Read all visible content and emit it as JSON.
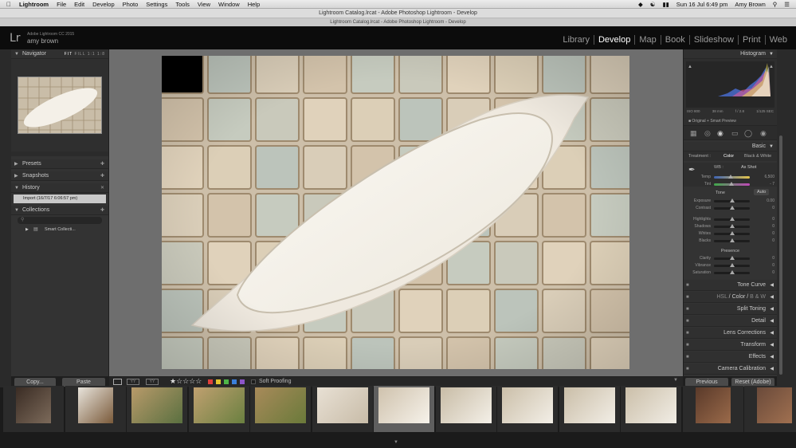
{
  "menubar": {
    "app": "Lightroom",
    "items": [
      "File",
      "Edit",
      "Develop",
      "Photo",
      "Settings",
      "Tools",
      "View",
      "Window",
      "Help"
    ],
    "clock": "Sun 16 Jul  6:49 pm",
    "user": "Amy Brown"
  },
  "window": {
    "title": "Lightroom Catalog.lrcat - Adobe Photoshop Lightroom - Develop",
    "tab": "Lightroom Catalog.lrcat - Adobe Photoshop Lightroom - Develop"
  },
  "identity": {
    "logo": "Lr",
    "version": "Adobe Lightroom CC 2015",
    "user": "amy brown"
  },
  "modules": [
    "Library",
    "Develop",
    "Map",
    "Book",
    "Slideshow",
    "Print",
    "Web"
  ],
  "active_module": "Develop",
  "left_panel": {
    "navigator": {
      "title": "Navigator",
      "zoom": [
        "FIT",
        "FILL",
        "1:1",
        "1:8"
      ]
    },
    "presets": "Presets",
    "snapshots": "Snapshots",
    "history": {
      "title": "History",
      "entries": [
        "Import (16/7/17 6:06:57 pm)"
      ]
    },
    "collections": {
      "title": "Collections",
      "items": [
        "Smart Collecti..."
      ]
    }
  },
  "right_panel": {
    "histogram": {
      "title": "Histogram",
      "iso": "ISO 800",
      "focal": "38 mm",
      "aperture": "f / 2.8",
      "shutter": "1/125 SEC",
      "preview": "Original + Smart Preview"
    },
    "basic": {
      "title": "Basic",
      "treatment_label": "Treatment :",
      "treatment_options": [
        "Color",
        "Black & White"
      ],
      "wb_label": "WB :",
      "wb_value": "As Shot",
      "temp": {
        "label": "Temp",
        "value": "6,500",
        "pos": 0.45
      },
      "tint": {
        "label": "Tint",
        "value": "- 7",
        "pos": 0.47
      },
      "tone_label": "Tone",
      "auto_label": "Auto",
      "tone_sliders": [
        {
          "label": "Exposure",
          "value": "0.00"
        },
        {
          "label": "Contrast",
          "value": "0"
        },
        {
          "label": "Highlights",
          "value": "0"
        },
        {
          "label": "Shadows",
          "value": "0"
        },
        {
          "label": "Whites",
          "value": "0"
        },
        {
          "label": "Blacks",
          "value": "0"
        }
      ],
      "presence_label": "Presence",
      "presence_sliders": [
        {
          "label": "Clarity",
          "value": "0"
        },
        {
          "label": "Vibrance",
          "value": "0"
        },
        {
          "label": "Saturation",
          "value": "0"
        }
      ]
    },
    "sections": [
      "Tone Curve",
      "HSL / Color / B & W",
      "Split Toning",
      "Detail",
      "Lens Corrections",
      "Transform",
      "Effects",
      "Camera Calibration"
    ],
    "hsl_parts": [
      "HSL",
      "Color",
      "B & W"
    ]
  },
  "toolbar": {
    "copy": "Copy...",
    "paste": "Paste",
    "soft_proofing": "Soft Proofing",
    "previous": "Previous",
    "reset": "Reset (Adobe)"
  },
  "filmstrip": {
    "count": 12,
    "selected_index": 5
  },
  "colors": {
    "label_red": "#e0403a",
    "label_yellow": "#e3c52f",
    "label_green": "#4fb648",
    "label_blue": "#3b7fd9",
    "label_purple": "#8c55c8"
  }
}
